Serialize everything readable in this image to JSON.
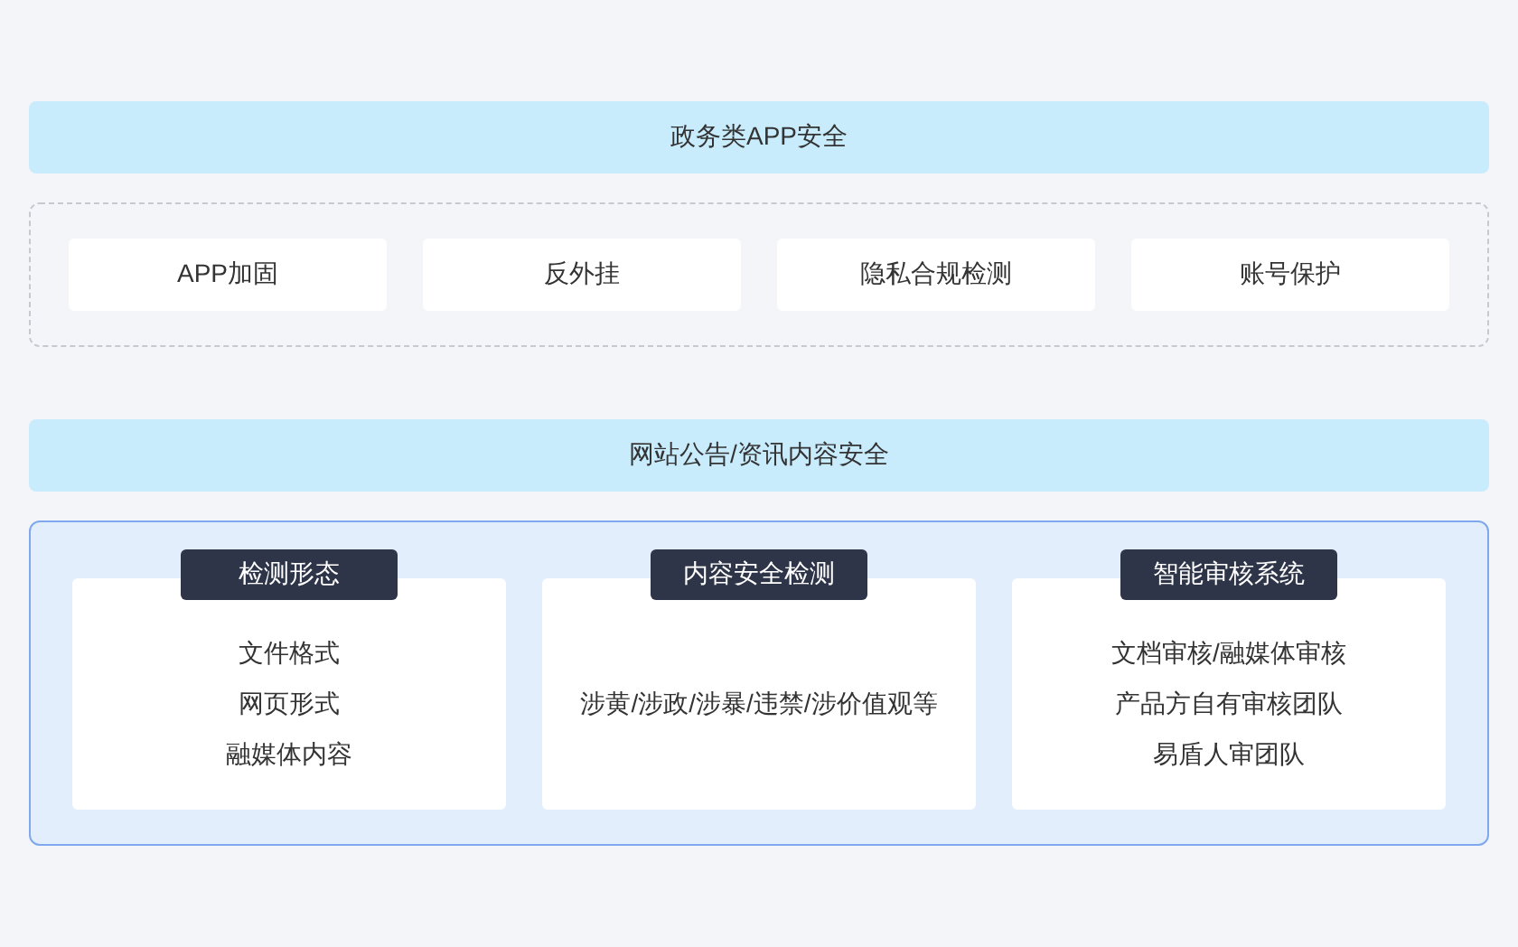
{
  "sections": [
    {
      "title": "政务类APP安全",
      "kind": "simple",
      "items": [
        {
          "label": "APP加固"
        },
        {
          "label": "反外挂"
        },
        {
          "label": "隐私合规检测"
        },
        {
          "label": "账号保护"
        }
      ]
    },
    {
      "title": "网站公告/资讯内容安全",
      "kind": "detailed",
      "cards": [
        {
          "tag": "检测形态",
          "lines": [
            "文件格式",
            "网页形式",
            "融媒体内容"
          ]
        },
        {
          "tag": "内容安全检测",
          "lines": [
            "涉黄/涉政/涉暴/违禁/涉价值观等"
          ]
        },
        {
          "tag": "智能审核系统",
          "lines": [
            "文档审核/融媒体审核",
            "产品方自有审核团队",
            "易盾人审团队"
          ]
        }
      ]
    }
  ]
}
